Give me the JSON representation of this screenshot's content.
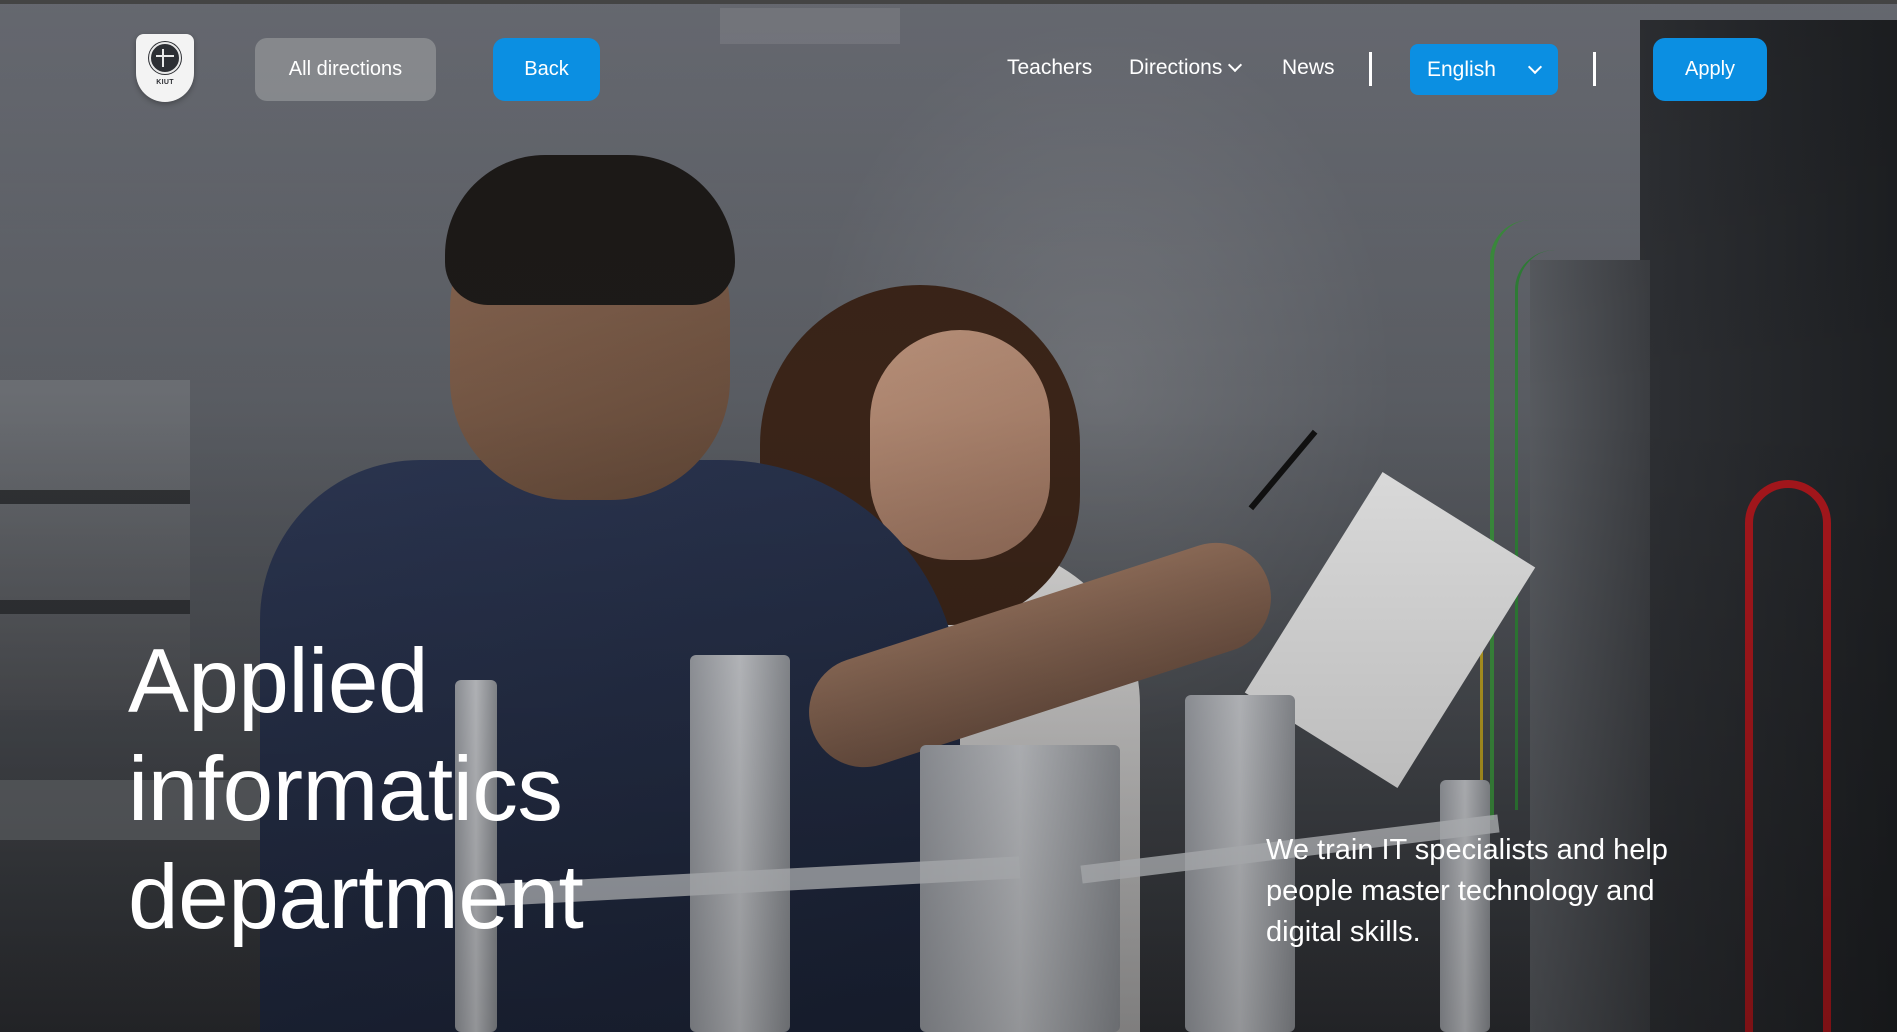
{
  "header": {
    "logo_text": "KIUT",
    "all_directions_label": "All directions",
    "back_label": "Back",
    "nav": {
      "teachers": "Teachers",
      "directions": "Directions",
      "news": "News"
    },
    "language": "English",
    "apply_label": "Apply"
  },
  "hero": {
    "title_lines": [
      "Applied",
      "informatics",
      "department"
    ],
    "subtitle": "We train IT specialists and help people master technology and digital skills."
  },
  "colors": {
    "accent": "#0b8fe2",
    "secondary_button": "#8c8e92",
    "text": "#ffffff"
  },
  "icons": {
    "logo": "university-globe-emblem-icon",
    "dropdown": "chevron-down-icon"
  }
}
